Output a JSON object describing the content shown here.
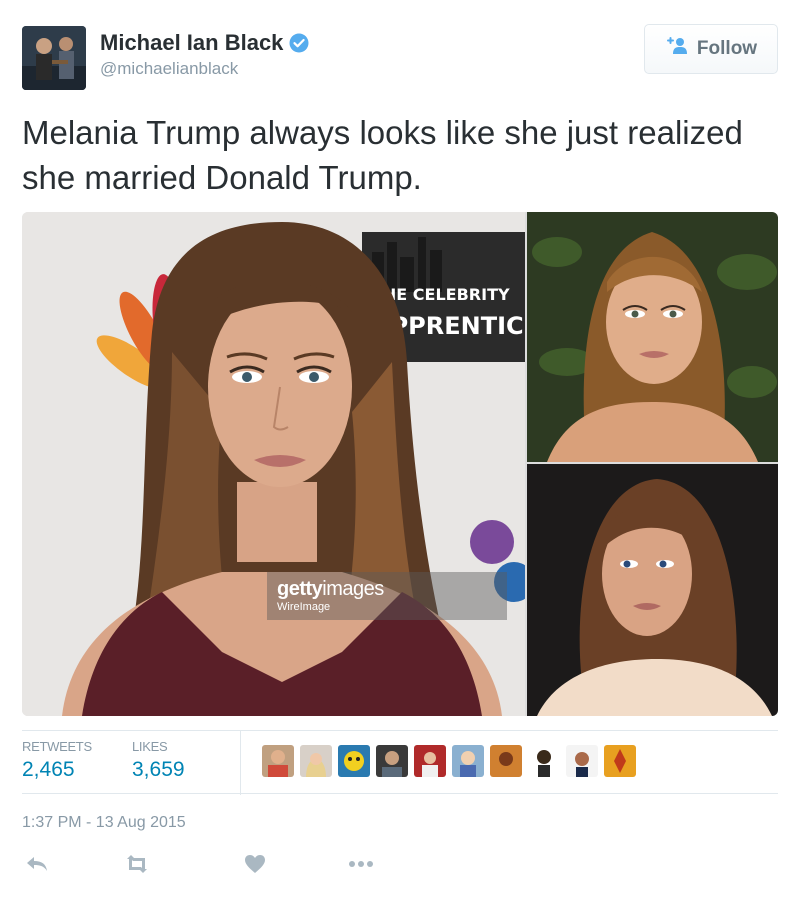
{
  "user": {
    "display_name": "Michael Ian Black",
    "handle": "@michaelianblack",
    "verified_icon": "verified-badge-icon"
  },
  "follow": {
    "label": "Follow",
    "icon": "add-person-icon"
  },
  "tweet": {
    "text": "Melania Trump always looks like she just realized she married Donald Trump."
  },
  "media": {
    "watermark_brand_bold": "getty",
    "watermark_brand_rest": "images",
    "watermark_sub": "WireImage",
    "backdrop_line1": "THE CELEBRITY",
    "backdrop_line2": "APPRENTICE"
  },
  "stats": {
    "retweets_label": "RETWEETS",
    "retweets_value": "2,465",
    "likes_label": "LIKES",
    "likes_value": "3,659"
  },
  "timestamp": "1:37 PM - 13 Aug 2015",
  "actions": [
    "reply-icon",
    "retweet-icon",
    "like-icon",
    "more-icon"
  ],
  "colors": {
    "link": "#0084b4",
    "muted": "#8899a6",
    "text": "#292f33",
    "verified": "#55acee"
  }
}
